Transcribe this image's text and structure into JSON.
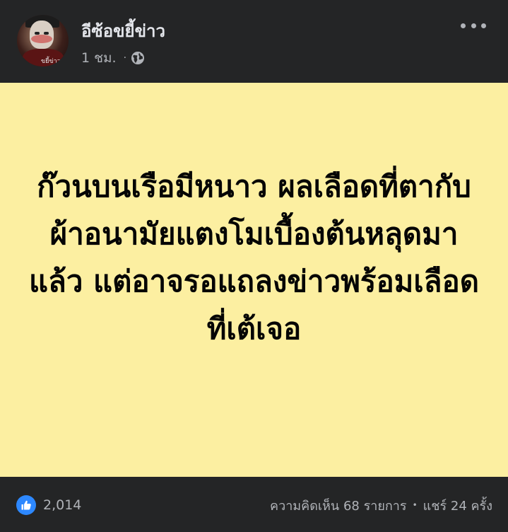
{
  "post": {
    "author_name": "อีซ้อขยี้ข่าว",
    "timestamp": "1 ชม.",
    "meta_separator": "·",
    "privacy_icon": "globe-icon",
    "body_text": "ก๊วนบนเรือมีหนาว ผลเลือดที่ตากับผ้าอนามัยแตงโมเบื้องต้นหลุดมาแล้ว แต่อาจรอแถลงข่าวพร้อมเลือดที่เต้เจอ",
    "background_color": "#fcefa1"
  },
  "avatar": {
    "watermark": "ขยี้ข่าว"
  },
  "reactions": {
    "icon": "like-icon",
    "count": "2,014"
  },
  "stats": {
    "comments": "ความคิดเห็น 68 รายการ",
    "separator": "•",
    "shares": "แชร์ 24 ครั้ง"
  },
  "colors": {
    "surface": "#242526",
    "secondary_text": "#b0b3b8",
    "like_blue": "#2d88ff"
  }
}
